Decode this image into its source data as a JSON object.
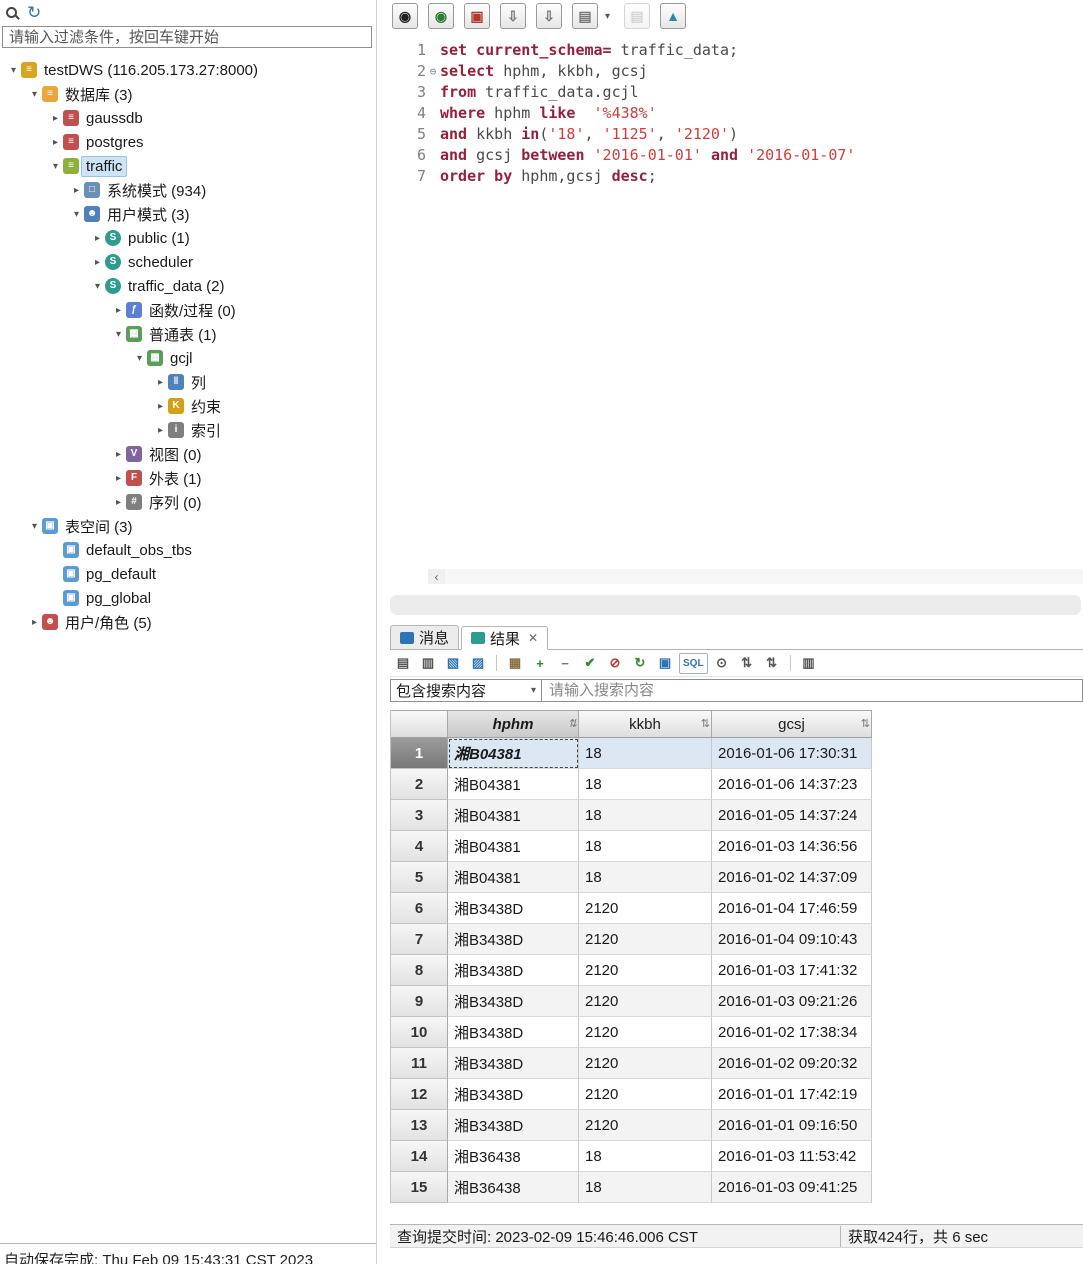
{
  "sidebar": {
    "toolbar": [
      {
        "name": "search-icon"
      },
      {
        "name": "refresh-icon",
        "glyph": "↻"
      }
    ],
    "filter_placeholder": "请输入过滤条件，按回车键开始",
    "status": "自动保存完成: Thu Feb 09 15:43:31 CST 2023",
    "chevron_glyphs": {
      "expanded": "▾",
      "collapsed": "▸"
    },
    "icon_styles": {
      "server": {
        "glyph": "≡",
        "bg": "#d8a520"
      },
      "db-folder": {
        "glyph": "≡",
        "bg": "#e8a63c"
      },
      "database": {
        "glyph": "≡",
        "bg": "#c0504d"
      },
      "database-active": {
        "glyph": "≡",
        "bg": "#8fae3a"
      },
      "schema-folder": {
        "glyph": "□",
        "bg": "#6b8fb5"
      },
      "user-schema-folder": {
        "glyph": "☻",
        "bg": "#4f81bd"
      },
      "schema": {
        "glyph": "S",
        "bg": "#2e9b8f",
        "round": true
      },
      "function-folder": {
        "glyph": "ƒ",
        "bg": "#5b7fd4"
      },
      "table-folder": {
        "glyph": "▦",
        "bg": "#5a9e5a"
      },
      "table": {
        "glyph": "▦",
        "bg": "#5a9e5a"
      },
      "columns": {
        "glyph": "‖",
        "bg": "#4f81bd"
      },
      "constraint": {
        "glyph": "K",
        "bg": "#d4a017"
      },
      "index": {
        "glyph": "i",
        "bg": "#7f7f7f"
      },
      "view-folder": {
        "glyph": "V",
        "bg": "#8064a2"
      },
      "foreign-table-folder": {
        "glyph": "F",
        "bg": "#c0504d"
      },
      "sequence-folder": {
        "glyph": "#",
        "bg": "#7f7f7f"
      },
      "tablespace-folder": {
        "glyph": "▣",
        "bg": "#5b9bd5"
      },
      "tablespace": {
        "glyph": "▣",
        "bg": "#5b9bd5"
      },
      "users": {
        "glyph": "☻",
        "bg": "#c0504d"
      }
    },
    "tree": [
      {
        "id": "testdws",
        "label": "testDWS (116.205.173.27:8000)",
        "level": 0,
        "chevron": "expanded",
        "icon": "server"
      },
      {
        "id": "databases",
        "label": "数据库 (3)",
        "level": 1,
        "chevron": "expanded",
        "icon": "db-folder"
      },
      {
        "id": "gaussdb",
        "label": "gaussdb",
        "level": 2,
        "chevron": "collapsed",
        "icon": "database"
      },
      {
        "id": "postgres",
        "label": "postgres",
        "level": 2,
        "chevron": "collapsed",
        "icon": "database"
      },
      {
        "id": "traffic",
        "label": "traffic",
        "level": 2,
        "chevron": "expanded",
        "icon": "database-active",
        "selected": true
      },
      {
        "id": "system-schemas",
        "label": "系统模式 (934)",
        "level": 3,
        "chevron": "collapsed",
        "icon": "schema-folder"
      },
      {
        "id": "user-schemas",
        "label": "用户模式 (3)",
        "level": 3,
        "chevron": "expanded",
        "icon": "user-schema-folder"
      },
      {
        "id": "public",
        "label": "public (1)",
        "level": 4,
        "chevron": "collapsed",
        "icon": "schema"
      },
      {
        "id": "scheduler",
        "label": "scheduler",
        "level": 4,
        "chevron": "collapsed",
        "icon": "schema"
      },
      {
        "id": "traffic-data",
        "label": "traffic_data (2)",
        "level": 4,
        "chevron": "expanded",
        "icon": "schema"
      },
      {
        "id": "functions",
        "label": "函数/过程 (0)",
        "level": 5,
        "chevron": "collapsed",
        "icon": "function-folder"
      },
      {
        "id": "ordinary-tables",
        "label": "普通表 (1)",
        "level": 5,
        "chevron": "expanded",
        "icon": "table-folder"
      },
      {
        "id": "gcjl",
        "label": "gcjl",
        "level": 6,
        "chevron": "expanded",
        "icon": "table"
      },
      {
        "id": "columns",
        "label": "列",
        "level": 7,
        "chevron": "collapsed",
        "icon": "columns"
      },
      {
        "id": "constraints",
        "label": "约束",
        "level": 7,
        "chevron": "collapsed",
        "icon": "constraint"
      },
      {
        "id": "indexes",
        "label": "索引",
        "level": 7,
        "chevron": "collapsed",
        "icon": "index"
      },
      {
        "id": "views",
        "label": "视图 (0)",
        "level": 5,
        "chevron": "collapsed",
        "icon": "view-folder"
      },
      {
        "id": "foreign-tables",
        "label": "外表 (1)",
        "level": 5,
        "chevron": "collapsed",
        "icon": "foreign-table-folder"
      },
      {
        "id": "sequences",
        "label": "序列 (0)",
        "level": 5,
        "chevron": "collapsed",
        "icon": "sequence-folder"
      },
      {
        "id": "tablespaces",
        "label": "表空间 (3)",
        "level": 1,
        "chevron": "expanded",
        "icon": "tablespace-folder"
      },
      {
        "id": "default-obs-tbs",
        "label": "default_obs_tbs",
        "level": 2,
        "chevron": "none",
        "icon": "tablespace"
      },
      {
        "id": "pg-default",
        "label": "pg_default",
        "level": 2,
        "chevron": "none",
        "icon": "tablespace"
      },
      {
        "id": "pg-global",
        "label": "pg_global",
        "level": 2,
        "chevron": "none",
        "icon": "tablespace"
      },
      {
        "id": "users-roles",
        "label": "用户/角色 (5)",
        "level": 1,
        "chevron": "collapsed",
        "icon": "users"
      }
    ]
  },
  "editor": {
    "toolbar": [
      {
        "name": "execute-button",
        "glyph": "◉",
        "color": "#222222"
      },
      {
        "name": "execute-new-tab-button",
        "glyph": "◉",
        "color": "#2e7d32"
      },
      {
        "name": "save-query-button",
        "glyph": "▣",
        "color": "#b03a2e"
      },
      {
        "name": "export-query-button",
        "glyph": "⇩",
        "color": "#777777"
      },
      {
        "name": "export-all-queries-button",
        "glyph": "⇩",
        "color": "#777777"
      },
      {
        "name": "copy-result-button",
        "glyph": "▤",
        "color": "#777777",
        "caret": "▾"
      },
      {
        "name": "paste-button",
        "glyph": "▤",
        "color": "#999999",
        "disabled": true
      },
      {
        "name": "explain-plan-button",
        "glyph": "▲",
        "color": "#2e86ab"
      }
    ],
    "fold_glyph": "⊖",
    "lines": [
      {
        "num": 1,
        "segs": [
          {
            "t": "set current_schema=",
            "c": "kw"
          },
          {
            "t": " traffic_data;",
            "c": "id"
          }
        ]
      },
      {
        "num": 2,
        "fold": true,
        "segs": [
          {
            "t": "select",
            "c": "kw"
          },
          {
            "t": " hphm, kkbh, gcsj",
            "c": "id"
          }
        ]
      },
      {
        "num": 3,
        "segs": [
          {
            "t": "from",
            "c": "kw"
          },
          {
            "t": " traffic_data.gcjl",
            "c": "id"
          }
        ]
      },
      {
        "num": 4,
        "segs": [
          {
            "t": "where",
            "c": "kw"
          },
          {
            "t": " hphm ",
            "c": "id"
          },
          {
            "t": "like",
            "c": "kw"
          },
          {
            "t": "  ",
            "c": "id"
          },
          {
            "t": "'%438%'",
            "c": "str"
          }
        ]
      },
      {
        "num": 5,
        "segs": [
          {
            "t": "and",
            "c": "kw"
          },
          {
            "t": " kkbh ",
            "c": "id"
          },
          {
            "t": "in",
            "c": "kw"
          },
          {
            "t": "(",
            "c": "id"
          },
          {
            "t": "'18'",
            "c": "str"
          },
          {
            "t": ", ",
            "c": "id"
          },
          {
            "t": "'1125'",
            "c": "str"
          },
          {
            "t": ", ",
            "c": "id"
          },
          {
            "t": "'2120'",
            "c": "str"
          },
          {
            "t": ")",
            "c": "id"
          }
        ]
      },
      {
        "num": 6,
        "segs": [
          {
            "t": "and",
            "c": "kw"
          },
          {
            "t": " gcsj ",
            "c": "id"
          },
          {
            "t": "between",
            "c": "kw"
          },
          {
            "t": " ",
            "c": "id"
          },
          {
            "t": "'2016-01-01'",
            "c": "str"
          },
          {
            "t": " ",
            "c": "id"
          },
          {
            "t": "and",
            "c": "kw"
          },
          {
            "t": " ",
            "c": "id"
          },
          {
            "t": "'2016-01-07'",
            "c": "str"
          }
        ]
      },
      {
        "num": 7,
        "segs": [
          {
            "t": "order by",
            "c": "kw"
          },
          {
            "t": " hphm,gcsj ",
            "c": "id"
          },
          {
            "t": "desc",
            "c": "kw"
          },
          {
            "t": ";",
            "c": "id"
          }
        ]
      }
    ],
    "hscroll_left_arrow": "‹"
  },
  "results": {
    "tabs": [
      {
        "label": "消息",
        "icon": "messages-tab-icon",
        "icon_color": "#2e74b5",
        "active": false,
        "closable": false
      },
      {
        "label": "结果",
        "icon": "results-tab-icon",
        "icon_color": "#2e9b8f",
        "active": true,
        "closable": true,
        "close_glyph": "✕"
      }
    ],
    "toolbar": [
      {
        "name": "export-result-icon",
        "glyph": "▤",
        "color": "#555555"
      },
      {
        "name": "export-all-results-icon",
        "glyph": "▥",
        "color": "#555555"
      },
      {
        "name": "edit-result-icon",
        "glyph": "▧",
        "color": "#2e74b5"
      },
      {
        "name": "edit-all-results-icon",
        "glyph": "▨",
        "color": "#2e74b5"
      },
      {
        "sep": true
      },
      {
        "name": "paste-icon",
        "glyph": "▦",
        "color": "#8a6d3b"
      },
      {
        "name": "insert-row-icon",
        "glyph": "+",
        "color": "#2e8b2e"
      },
      {
        "name": "delete-row-icon",
        "glyph": "−",
        "color": "#777777"
      },
      {
        "name": "commit-changes-icon",
        "glyph": "✔",
        "color": "#2e8b2e"
      },
      {
        "name": "rollback-changes-icon",
        "glyph": "⊘",
        "color": "#c0392b"
      },
      {
        "name": "refresh-grid-icon",
        "glyph": "↻",
        "color": "#2e8b2e"
      },
      {
        "name": "show-in-editor-icon",
        "glyph": "▣",
        "color": "#2e74b5"
      },
      {
        "name": "generate-sql-icon",
        "glyph": "SQL",
        "text": true,
        "color": "#2e74b5"
      },
      {
        "name": "search-grid-icon",
        "glyph": "⊙",
        "color": "#555555"
      },
      {
        "name": "sort-ascending-icon",
        "glyph": "⇅",
        "color": "#555555"
      },
      {
        "name": "sort-descending-icon",
        "glyph": "⇅",
        "color": "#555555"
      },
      {
        "sep": true
      },
      {
        "name": "column-settings-icon",
        "glyph": "▥",
        "color": "#555555"
      }
    ],
    "search": {
      "dropdown_value": "包含搜索内容",
      "dropdown_caret": "▾",
      "input_placeholder": "请输入搜索内容"
    },
    "table": {
      "sort_glyph": "⇅",
      "columns": [
        "hphm",
        "kkbh",
        "gcsj"
      ],
      "selected_column": "hphm",
      "selected_row": 1,
      "rows": [
        [
          "湘B04381",
          "18",
          "2016-01-06 17:30:31"
        ],
        [
          "湘B04381",
          "18",
          "2016-01-06 14:37:23"
        ],
        [
          "湘B04381",
          "18",
          "2016-01-05 14:37:24"
        ],
        [
          "湘B04381",
          "18",
          "2016-01-03 14:36:56"
        ],
        [
          "湘B04381",
          "18",
          "2016-01-02 14:37:09"
        ],
        [
          "湘B3438D",
          "2120",
          "2016-01-04 17:46:59"
        ],
        [
          "湘B3438D",
          "2120",
          "2016-01-04 09:10:43"
        ],
        [
          "湘B3438D",
          "2120",
          "2016-01-03 17:41:32"
        ],
        [
          "湘B3438D",
          "2120",
          "2016-01-03 09:21:26"
        ],
        [
          "湘B3438D",
          "2120",
          "2016-01-02 17:38:34"
        ],
        [
          "湘B3438D",
          "2120",
          "2016-01-02 09:20:32"
        ],
        [
          "湘B3438D",
          "2120",
          "2016-01-01 17:42:19"
        ],
        [
          "湘B3438D",
          "2120",
          "2016-01-01 09:16:50"
        ],
        [
          "湘B36438",
          "18",
          "2016-01-03 11:53:42"
        ],
        [
          "湘B36438",
          "18",
          "2016-01-03 09:41:25"
        ]
      ]
    },
    "status_left": "查询提交时间: 2023-02-09 15:46:46.006 CST",
    "status_right": "获取424行，共 6 sec"
  }
}
